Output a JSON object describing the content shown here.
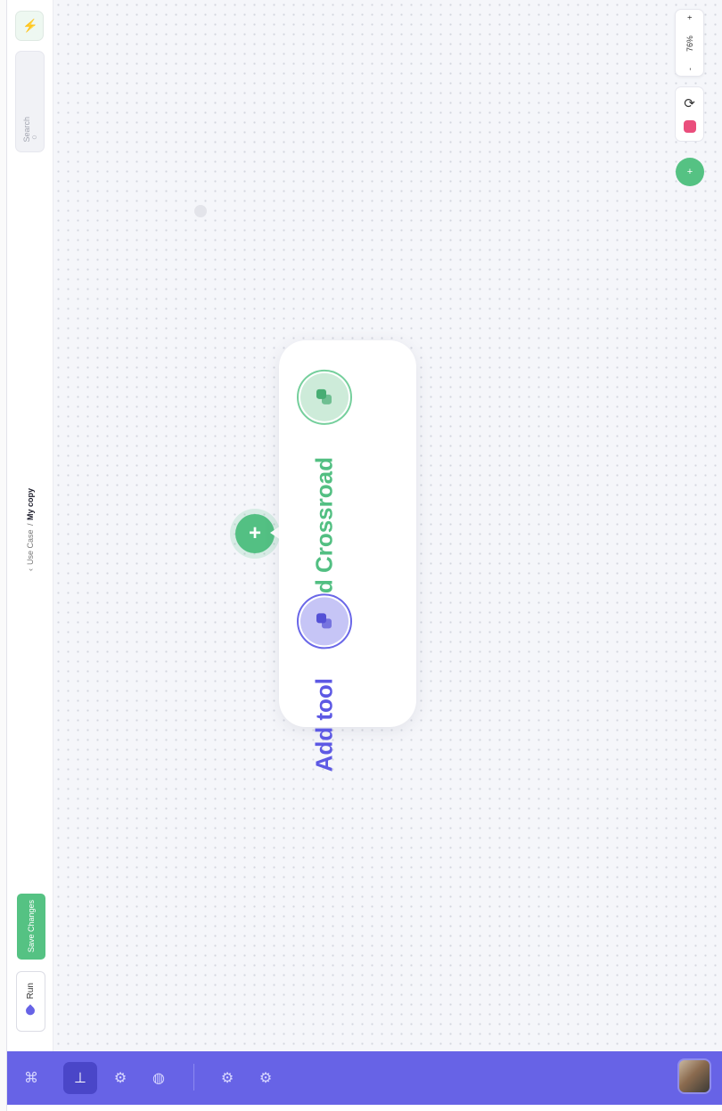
{
  "app": {
    "breadcrumb": {
      "back_icon": "chevron-left-icon",
      "parent": "Use Case",
      "separator": "/",
      "current": "My copy"
    },
    "search": {
      "placeholder": "Search",
      "icon": "search-icon"
    },
    "magic_button": {
      "icon": "magic-wand-icon"
    },
    "actions": {
      "save_label": "Save Changes",
      "run_label": "Run"
    }
  },
  "canvas": {
    "zoom": {
      "minus": "-",
      "value": "76%",
      "plus": "+"
    },
    "add_node": {
      "plus_label": "+"
    },
    "popover": {
      "options": [
        {
          "label": "Add Crossroad",
          "icon": "crossroad-icon",
          "color": "#52bf82"
        },
        {
          "label": "Add tool",
          "icon": "tool-icon",
          "color": "#5d59e4"
        }
      ]
    }
  },
  "nav": {
    "items": [
      {
        "name": "command-icon",
        "glyph": "⌘"
      },
      {
        "name": "flow-icon",
        "glyph": "⊥",
        "active": true
      },
      {
        "name": "nodes-icon",
        "glyph": "⚙"
      },
      {
        "name": "globe-icon",
        "glyph": "◍"
      },
      {
        "name": "settings-icon",
        "glyph": "⚙"
      },
      {
        "name": "integrations-icon",
        "glyph": "⚙"
      }
    ],
    "accent": "#6763e6"
  }
}
